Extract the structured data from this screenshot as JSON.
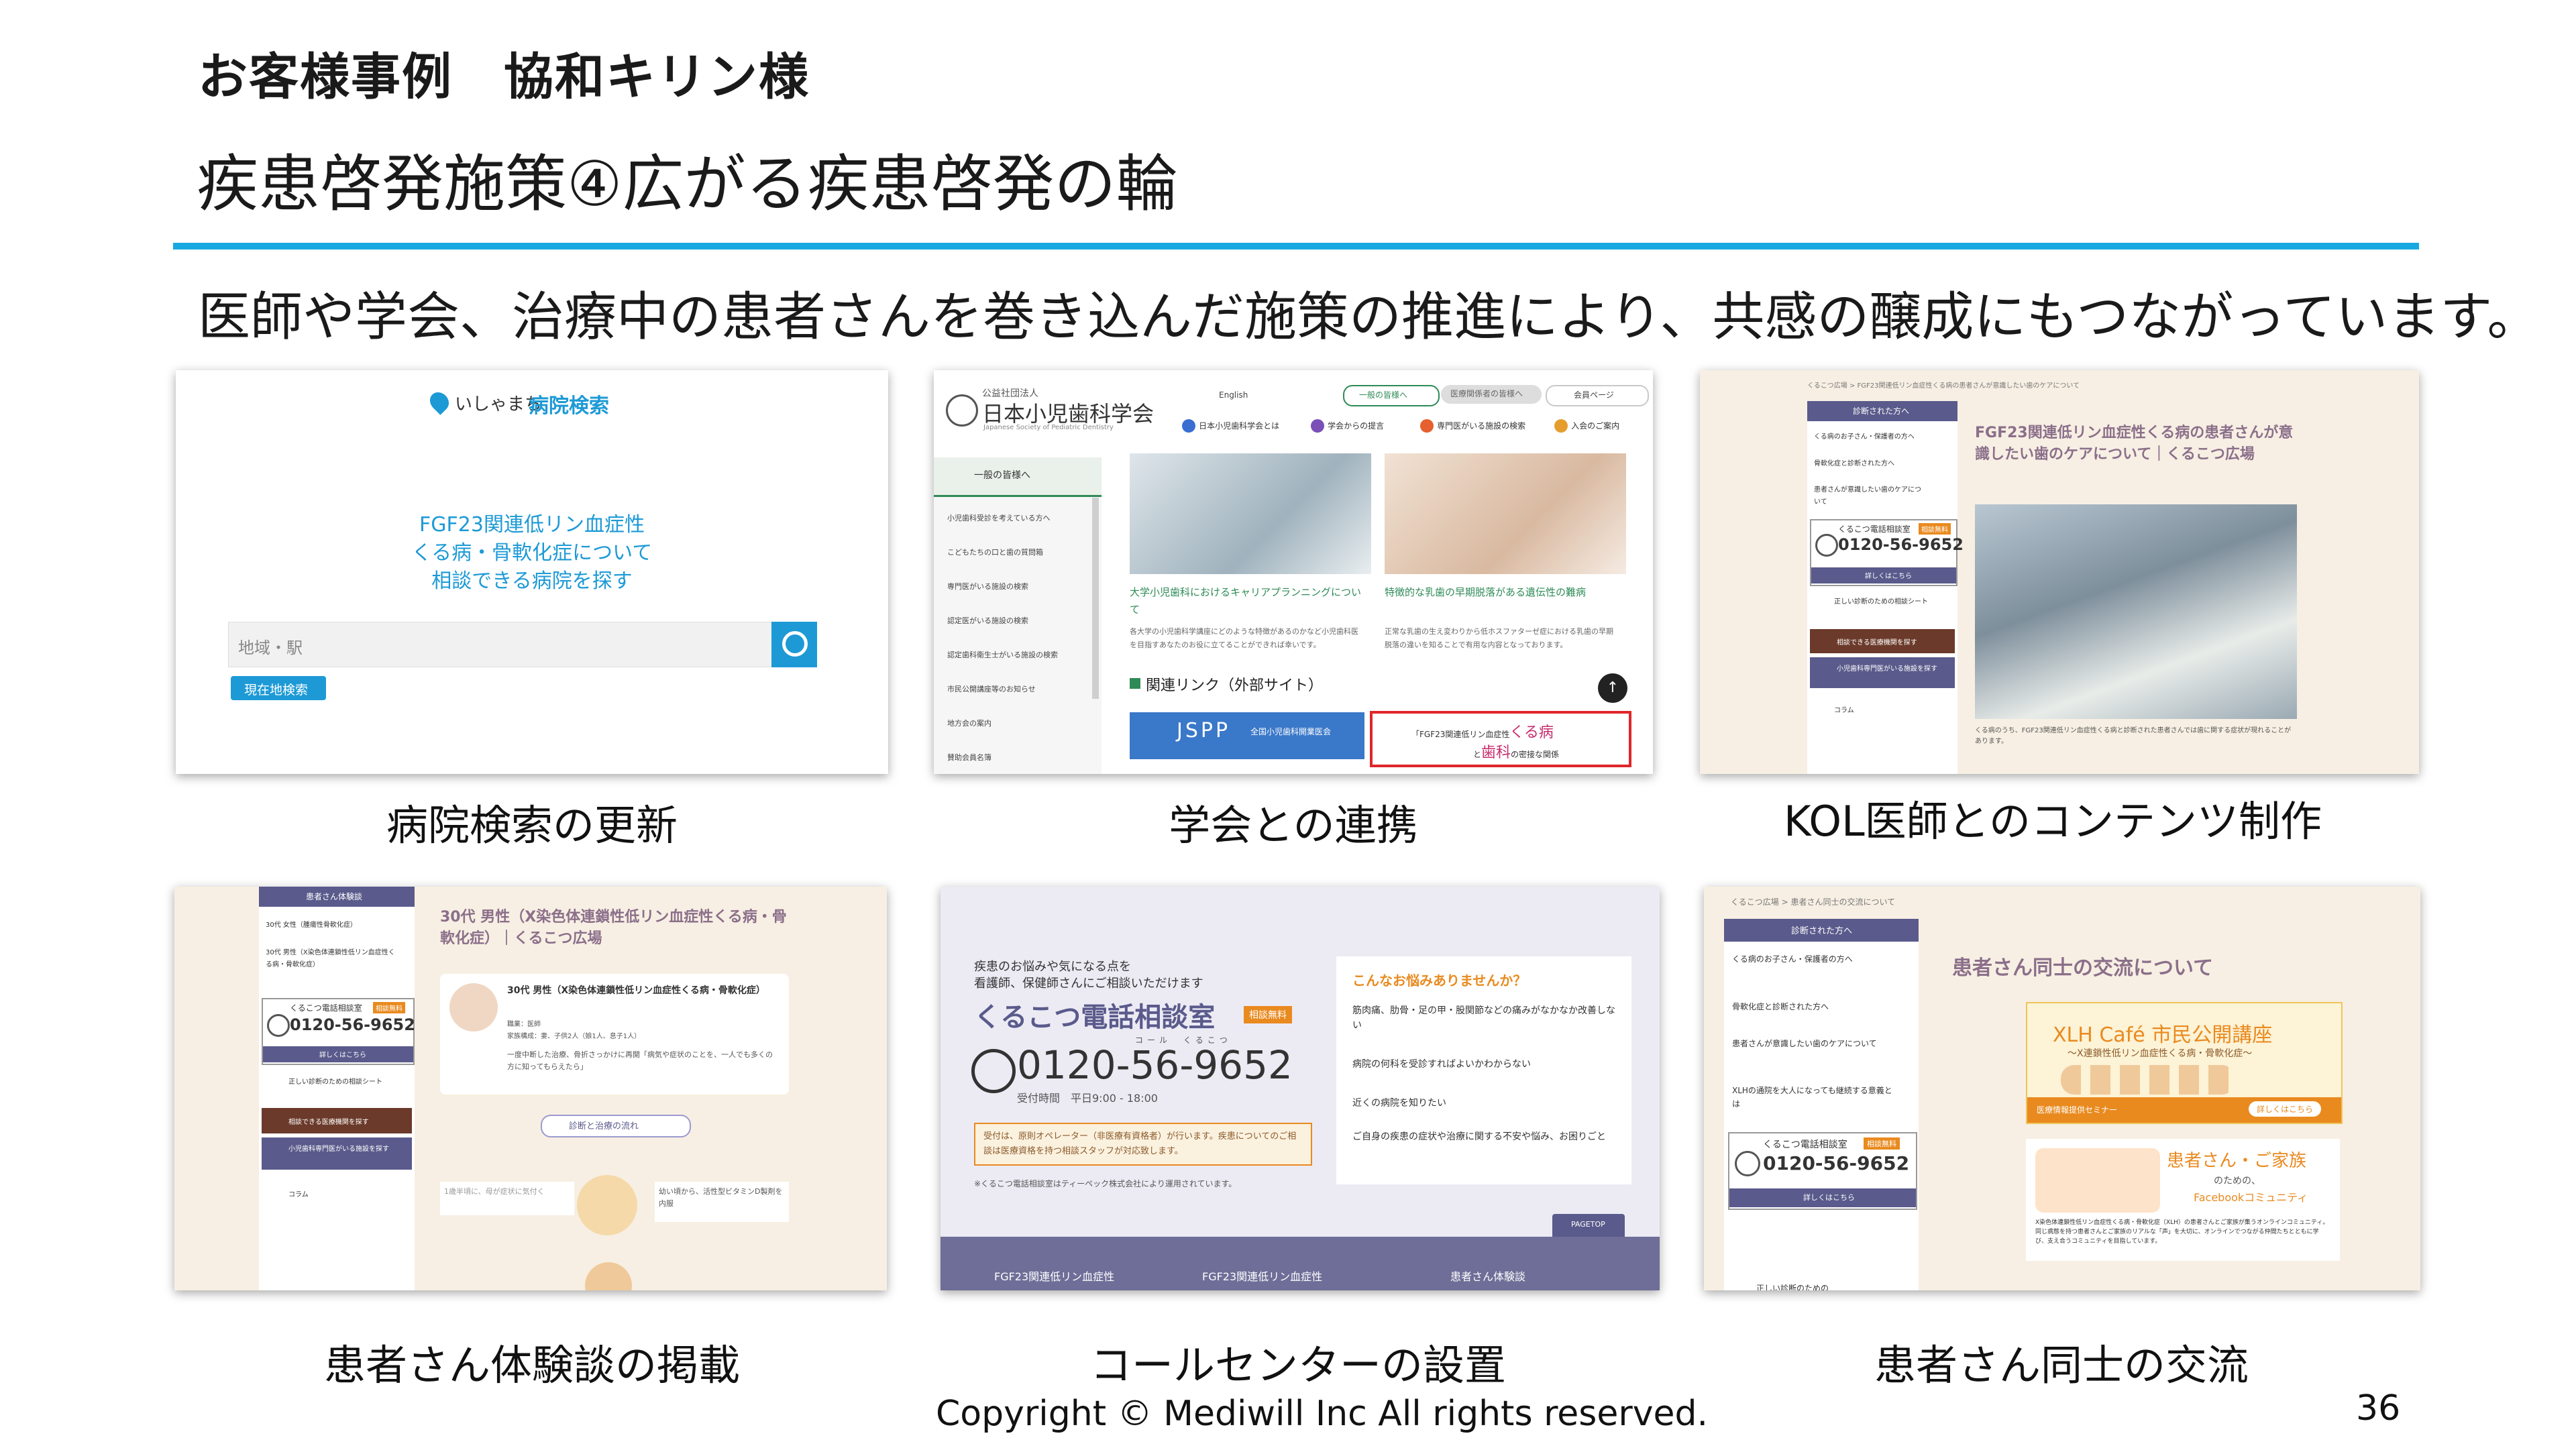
{
  "header": {
    "subtitle": "お客様事例　協和キリン様",
    "title": "疾患啓発施策④広がる疾患啓発の輪",
    "lead": "医師や学会、治療中の患者さんを巻き込んだ施策の推進により、共感の醸成にもつながっています。"
  },
  "captions": [
    "病院検索の更新",
    "学会との連携",
    "KOL医師とのコンテンツ制作",
    "患者さん体験談の掲載",
    "コールセンターの設置",
    "患者さん同士の交流"
  ],
  "shot1": {
    "logo": "いしゃまち",
    "logo_strong": "病院検索",
    "heading": [
      "FGF23関連低リン血症性",
      "くる病・骨軟化症について",
      "相談できる病院を探す"
    ],
    "search_placeholder": "地域・駅",
    "location_button": "現在地検索"
  },
  "shot2": {
    "org_small": "公益社団法人",
    "org": "日本小児歯科学会",
    "org_en": "Japanese Society of Pediatric Dentistry",
    "top_links": [
      "English",
      "一般の皆様へ",
      "医療関係者の皆様へ",
      "会員ページ"
    ],
    "nav": [
      "日本小児歯科学会とは",
      "学会からの提言",
      "専門医がいる施設の検索",
      "入会のご案内"
    ],
    "side_title": "一般の皆様へ",
    "side": [
      "小児歯科受診を考えている方へ",
      "こどもたちの口と歯の質問箱",
      "専門医がいる施設の検索",
      "認定医がいる施設の検索",
      "認定歯科衛生士がいる施設の検索",
      "市民公開講座等のお知らせ",
      "地方会の案内",
      "賛助会員名簿"
    ],
    "article1_title": "大学小児歯科におけるキャリアプランニングについて",
    "article1_body": "各大学の小児歯科学講座にどのような特徴があるのかなど小児歯科医を目指すあなたのお役に立てることができれば幸いです。",
    "article2_title": "特徴的な乳歯の早期脱落がある遺伝性の難病",
    "article2_body": "正常な乳歯の生え変わりから低ホスファターゼ症における乳歯の早期脱落の違いを知ることで有用な内容となっております。",
    "links_heading": "関連リンク（外部サイト）",
    "jspp": "JSPP",
    "jspp_sub": "全国小児歯科開業医会",
    "banner_line1": "「FGF23関連低リン血症性",
    "banner_big1": "くる病",
    "banner_line2": "と",
    "banner_big2": "歯科",
    "banner_line3": "の密接な関係"
  },
  "shot3": {
    "breadcrumb": "くるこつ広場 > FGF23関連低リン血症性くる病の患者さんが意識したい歯のケアについて",
    "side_head": "診断された方へ",
    "side": [
      "くる病のお子さん・保護者の方へ",
      "骨軟化症と診断された方へ",
      "患者さんが意識したい歯のケアについて"
    ],
    "call_title": "くるこつ電話相談室",
    "call_badge": "相談無料",
    "phone": "0120-56-9652",
    "detail": "詳しくはこちら",
    "side2": [
      "正しい診断のための相談シート",
      "相談できる医療機関を探す",
      "小児歯科専門医がいる施設を探す",
      "コラム"
    ],
    "article_title": "FGF23関連低リン血症性くる病の患者さんが意識したい歯のケアについて｜くるこつ広場",
    "body": "くる病のうち、FGF23関連低リン血症性くる病と診断された患者さんでは歯に関する症状が現れることがあります。"
  },
  "shot4": {
    "side": [
      "患者さん体験談",
      "30代 女性（腫瘍性骨軟化症）",
      "30代 男性（X染色体連鎖性低リン血症性くる病・骨軟化症）"
    ],
    "call_title": "くるこつ電話相談室",
    "call_badge": "相談無料",
    "phone": "0120-56-9652",
    "detail": "詳しくはこちら",
    "side2": [
      "正しい診断のための相談シート",
      "相談できる医療機関を探す",
      "小児歯科専門医がいる施設を探す",
      "コラム"
    ],
    "article_title": "30代 男性（X染色体連鎖性低リン血症性くる病・骨軟化症）｜くるこつ広場",
    "profile_title": "30代 男性（X染色体連鎖性低リン血症性くる病・骨軟化症）",
    "profile_job": "職業：医師",
    "profile_family": "家族構成：妻、子供2人（娘1人、息子1人）",
    "quote": "一度中断した治療、骨折さっかけに再開「病気や症状のことを、一人でも多くの方に知ってもらえたら」",
    "flow_label": "診断と治療の流れ",
    "note_left": "1歳半頃に、母が症状に気付く",
    "note_right": "幼い頃から、活性型ビタミンD製剤を内服"
  },
  "shot5": {
    "intro": [
      "疾患のお悩みや気になる点を",
      "看護師、保健師さんにご相談いただけます"
    ],
    "title": "くるこつ電話相談室",
    "badge": "相談無料",
    "phone": "0120-56-9652",
    "ruby": "コール　くるこつ",
    "hours": "受付時間　平日9:00 - 18:00",
    "notice": "受付は、原則オペレーター（非医療有資格者）が行います。疾患についてのご相談は医療資格を持つ相談スタッフが対応致します。",
    "footnote": "※くるこつ電話相談室はティーペック株式会社により運用されています。",
    "worries_title": "こんなお悩みありませんか？",
    "worries": [
      "筋肉痛、肋骨・足の甲・股関節などの痛みがなかなか改善しない",
      "病院の何科を受診すればよいかわからない",
      "近くの病院を知りたい",
      "ご自身の疾患の症状や治療に関する不安や悩み、お困りごと"
    ],
    "pagetop": "PAGETOP",
    "footer_items": [
      "FGF23関連低リン血症性",
      "FGF23関連低リン血症性",
      "患者さん体験談"
    ]
  },
  "shot6": {
    "breadcrumb": "くるこつ広場 > 患者さん同士の交流について",
    "side_head": "診断された方へ",
    "side": [
      "くる病のお子さん・保護者の方へ",
      "骨軟化症と診断された方へ",
      "患者さんが意識したい歯のケアについて",
      "XLHの通院を大人になっても継続する意義とは"
    ],
    "call_title": "くるこつ電話相談室",
    "call_badge": "相談無料",
    "phone": "0120-56-9652",
    "detail": "詳しくはこちら",
    "side2": "正しい診断のための",
    "article_title": "患者さん同士の交流について",
    "xlh_title": "XLH Café 市民公開講座",
    "xlh_sub": "〜X連鎖性低リン血症性くる病・骨軟化症〜",
    "xlh_seminar": "医療情報提供セミナー",
    "xlh_btn": "詳しくはこちら",
    "comm_title1": "患者さん・ご家族",
    "comm_title2": "のための、",
    "comm_title3": "Facebookコミュニティ",
    "comm_body": "X染色体連鎖性低リン血症性くる病・骨軟化症（XLH）の患者さんとご家族が集うオンラインコミュニティ。同じ病態を持つ患者さんとご家族のリアルな「声」を大切に、オンラインでつながる仲間たちとともに学び、支え合うコミュニティを目指しています。"
  },
  "footer": {
    "copyright": "Copyright © Mediwill Inc All rights reserved.",
    "page_number": "36"
  },
  "colors": {
    "rule": "#16a9e0",
    "shot1_accent": "#1d9ad6",
    "shot2_green": "#2e8b57",
    "kurukotsu_brown": "#6b3a2a",
    "kurukotsu_purple": "#5a5a8c",
    "kurukotsu_orange": "#e98a1f",
    "cream": "#f7efe3"
  }
}
